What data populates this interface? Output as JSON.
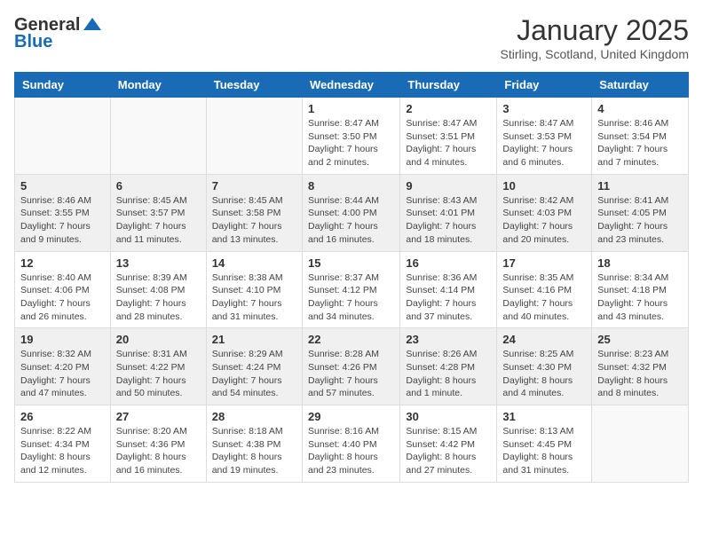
{
  "header": {
    "logo_general": "General",
    "logo_blue": "Blue",
    "month_title": "January 2025",
    "location": "Stirling, Scotland, United Kingdom"
  },
  "weekdays": [
    "Sunday",
    "Monday",
    "Tuesday",
    "Wednesday",
    "Thursday",
    "Friday",
    "Saturday"
  ],
  "weeks": [
    [
      {
        "day": "",
        "info": ""
      },
      {
        "day": "",
        "info": ""
      },
      {
        "day": "",
        "info": ""
      },
      {
        "day": "1",
        "info": "Sunrise: 8:47 AM\nSunset: 3:50 PM\nDaylight: 7 hours\nand 2 minutes."
      },
      {
        "day": "2",
        "info": "Sunrise: 8:47 AM\nSunset: 3:51 PM\nDaylight: 7 hours\nand 4 minutes."
      },
      {
        "day": "3",
        "info": "Sunrise: 8:47 AM\nSunset: 3:53 PM\nDaylight: 7 hours\nand 6 minutes."
      },
      {
        "day": "4",
        "info": "Sunrise: 8:46 AM\nSunset: 3:54 PM\nDaylight: 7 hours\nand 7 minutes."
      }
    ],
    [
      {
        "day": "5",
        "info": "Sunrise: 8:46 AM\nSunset: 3:55 PM\nDaylight: 7 hours\nand 9 minutes."
      },
      {
        "day": "6",
        "info": "Sunrise: 8:45 AM\nSunset: 3:57 PM\nDaylight: 7 hours\nand 11 minutes."
      },
      {
        "day": "7",
        "info": "Sunrise: 8:45 AM\nSunset: 3:58 PM\nDaylight: 7 hours\nand 13 minutes."
      },
      {
        "day": "8",
        "info": "Sunrise: 8:44 AM\nSunset: 4:00 PM\nDaylight: 7 hours\nand 16 minutes."
      },
      {
        "day": "9",
        "info": "Sunrise: 8:43 AM\nSunset: 4:01 PM\nDaylight: 7 hours\nand 18 minutes."
      },
      {
        "day": "10",
        "info": "Sunrise: 8:42 AM\nSunset: 4:03 PM\nDaylight: 7 hours\nand 20 minutes."
      },
      {
        "day": "11",
        "info": "Sunrise: 8:41 AM\nSunset: 4:05 PM\nDaylight: 7 hours\nand 23 minutes."
      }
    ],
    [
      {
        "day": "12",
        "info": "Sunrise: 8:40 AM\nSunset: 4:06 PM\nDaylight: 7 hours\nand 26 minutes."
      },
      {
        "day": "13",
        "info": "Sunrise: 8:39 AM\nSunset: 4:08 PM\nDaylight: 7 hours\nand 28 minutes."
      },
      {
        "day": "14",
        "info": "Sunrise: 8:38 AM\nSunset: 4:10 PM\nDaylight: 7 hours\nand 31 minutes."
      },
      {
        "day": "15",
        "info": "Sunrise: 8:37 AM\nSunset: 4:12 PM\nDaylight: 7 hours\nand 34 minutes."
      },
      {
        "day": "16",
        "info": "Sunrise: 8:36 AM\nSunset: 4:14 PM\nDaylight: 7 hours\nand 37 minutes."
      },
      {
        "day": "17",
        "info": "Sunrise: 8:35 AM\nSunset: 4:16 PM\nDaylight: 7 hours\nand 40 minutes."
      },
      {
        "day": "18",
        "info": "Sunrise: 8:34 AM\nSunset: 4:18 PM\nDaylight: 7 hours\nand 43 minutes."
      }
    ],
    [
      {
        "day": "19",
        "info": "Sunrise: 8:32 AM\nSunset: 4:20 PM\nDaylight: 7 hours\nand 47 minutes."
      },
      {
        "day": "20",
        "info": "Sunrise: 8:31 AM\nSunset: 4:22 PM\nDaylight: 7 hours\nand 50 minutes."
      },
      {
        "day": "21",
        "info": "Sunrise: 8:29 AM\nSunset: 4:24 PM\nDaylight: 7 hours\nand 54 minutes."
      },
      {
        "day": "22",
        "info": "Sunrise: 8:28 AM\nSunset: 4:26 PM\nDaylight: 7 hours\nand 57 minutes."
      },
      {
        "day": "23",
        "info": "Sunrise: 8:26 AM\nSunset: 4:28 PM\nDaylight: 8 hours\nand 1 minute."
      },
      {
        "day": "24",
        "info": "Sunrise: 8:25 AM\nSunset: 4:30 PM\nDaylight: 8 hours\nand 4 minutes."
      },
      {
        "day": "25",
        "info": "Sunrise: 8:23 AM\nSunset: 4:32 PM\nDaylight: 8 hours\nand 8 minutes."
      }
    ],
    [
      {
        "day": "26",
        "info": "Sunrise: 8:22 AM\nSunset: 4:34 PM\nDaylight: 8 hours\nand 12 minutes."
      },
      {
        "day": "27",
        "info": "Sunrise: 8:20 AM\nSunset: 4:36 PM\nDaylight: 8 hours\nand 16 minutes."
      },
      {
        "day": "28",
        "info": "Sunrise: 8:18 AM\nSunset: 4:38 PM\nDaylight: 8 hours\nand 19 minutes."
      },
      {
        "day": "29",
        "info": "Sunrise: 8:16 AM\nSunset: 4:40 PM\nDaylight: 8 hours\nand 23 minutes."
      },
      {
        "day": "30",
        "info": "Sunrise: 8:15 AM\nSunset: 4:42 PM\nDaylight: 8 hours\nand 27 minutes."
      },
      {
        "day": "31",
        "info": "Sunrise: 8:13 AM\nSunset: 4:45 PM\nDaylight: 8 hours\nand 31 minutes."
      },
      {
        "day": "",
        "info": ""
      }
    ]
  ]
}
